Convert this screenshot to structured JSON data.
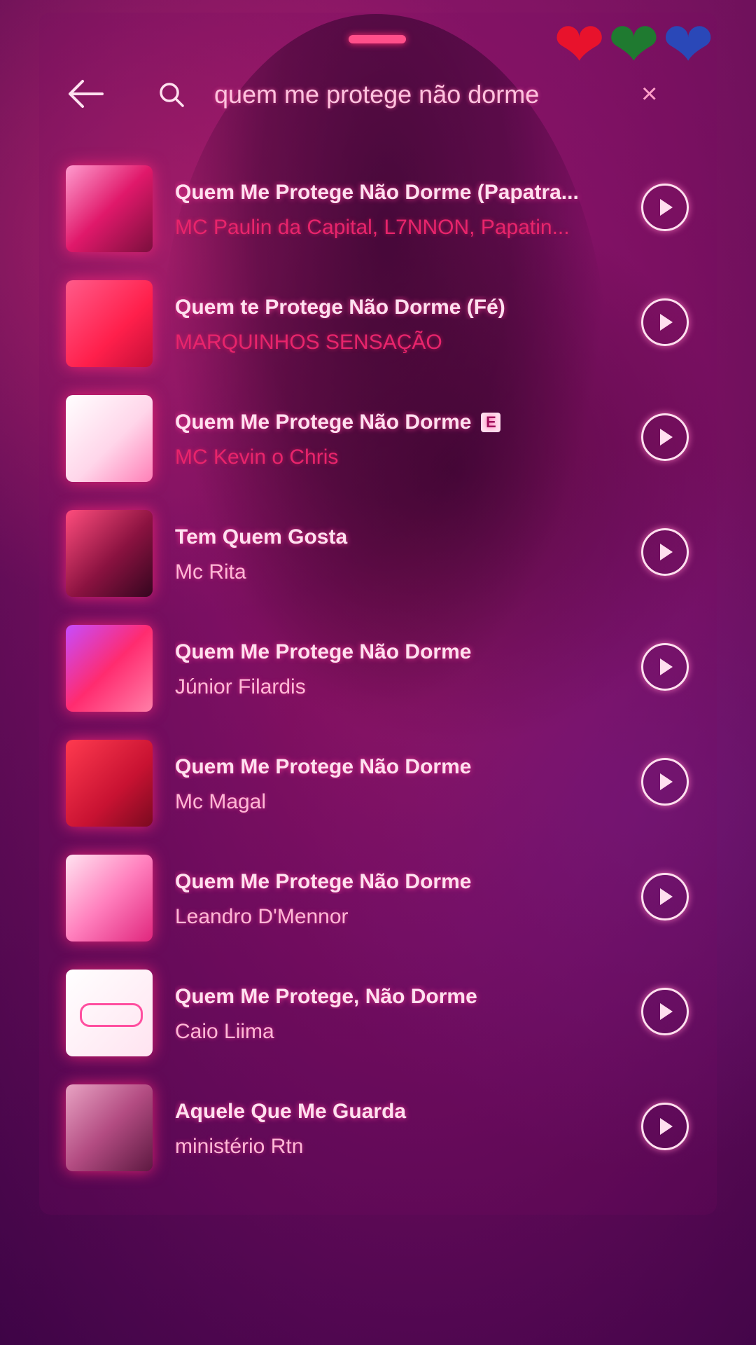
{
  "search": {
    "query": "quem me protege não dorme"
  },
  "header": {
    "hearts": [
      "❤",
      "❤",
      "❤"
    ],
    "heart_colors": [
      "#e8122c",
      "#1f7a30",
      "#2a48b8"
    ]
  },
  "results": [
    {
      "title": "Quem Me Protege Não Dorme (Papatra...",
      "artist": "MC Paulin da Capital, L7NNON, Papatin..."
    },
    {
      "title": "Quem te Protege Não Dorme (Fé)",
      "artist": "MARQUINHOS SENSAÇÃO"
    },
    {
      "title": "Quem Me Protege Não Dorme",
      "artist": "MC Kevin o Chris",
      "explicit": "E"
    },
    {
      "title": "Tem Quem Gosta",
      "artist": "Mc Rita"
    },
    {
      "title": "Quem Me Protege Não Dorme",
      "artist": "Júnior Filardis"
    },
    {
      "title": "Quem Me Protege Não Dorme",
      "artist": "Mc Magal"
    },
    {
      "title": "Quem Me Protege Não Dorme",
      "artist": "Leandro D'Mennor"
    },
    {
      "title": "Quem Me Protege, Não Dorme",
      "artist": "Caio Liima"
    },
    {
      "title": "Aquele Que Me Guarda",
      "artist": "ministério Rtn"
    }
  ]
}
